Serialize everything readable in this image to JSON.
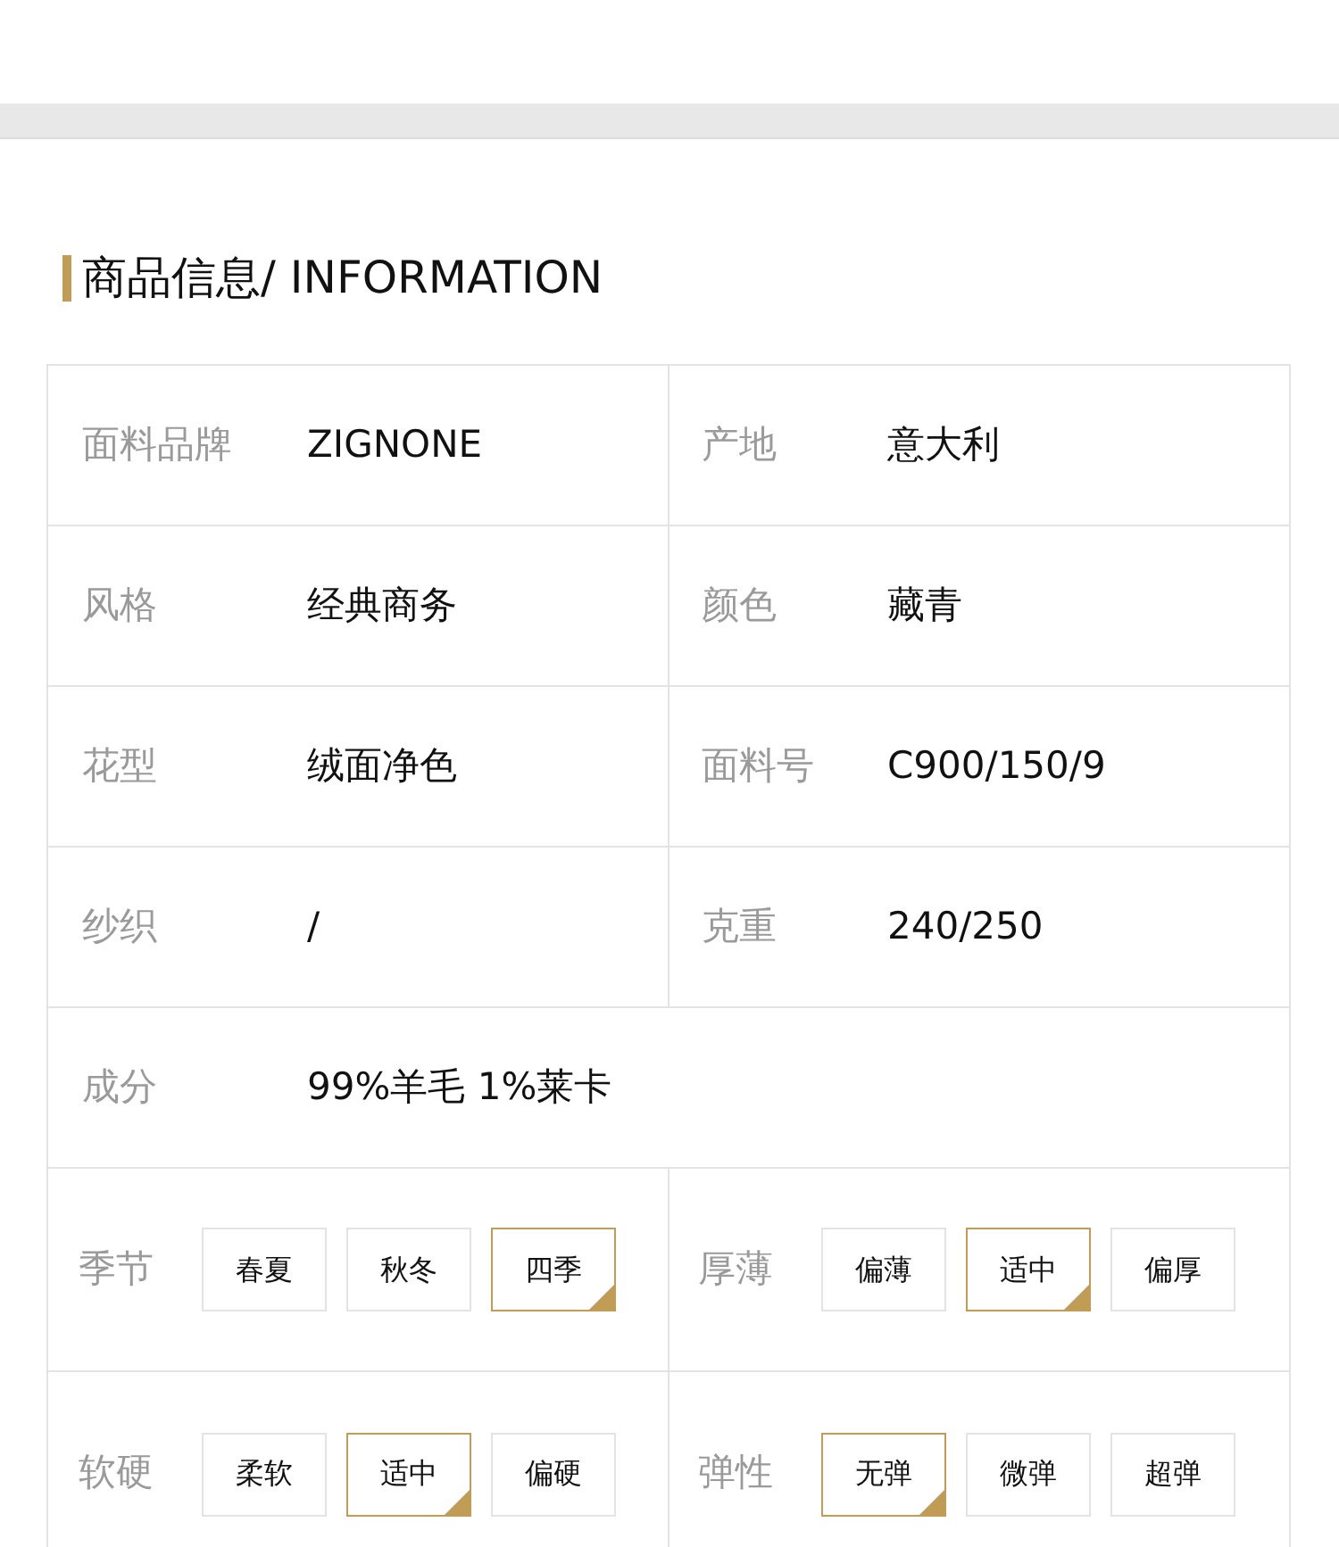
{
  "section_title": "商品信息/ INFORMATION",
  "info_rows": [
    {
      "cells": [
        {
          "label": "面料品牌",
          "value": "ZIGNONE"
        },
        {
          "label": "产地",
          "value": "意大利"
        }
      ]
    },
    {
      "cells": [
        {
          "label": "风格",
          "value": "经典商务"
        },
        {
          "label": "颜色",
          "value": "藏青"
        }
      ]
    },
    {
      "cells": [
        {
          "label": "花型",
          "value": "绒面净色"
        },
        {
          "label": "面料号",
          "value": "C900/150/9"
        }
      ]
    },
    {
      "cells": [
        {
          "label": "纱织",
          "value": "/"
        },
        {
          "label": "克重",
          "value": "240/250"
        }
      ]
    },
    {
      "cells": [
        {
          "label": "成分",
          "value": "99%羊毛 1%莱卡"
        }
      ]
    }
  ],
  "option_rows": [
    {
      "groups": [
        {
          "label": "季节",
          "options": [
            {
              "label": "春夏",
              "selected": false
            },
            {
              "label": "秋冬",
              "selected": false
            },
            {
              "label": "四季",
              "selected": true
            }
          ]
        },
        {
          "label": "厚薄",
          "options": [
            {
              "label": "偏薄",
              "selected": false
            },
            {
              "label": "适中",
              "selected": true
            },
            {
              "label": "偏厚",
              "selected": false
            }
          ]
        }
      ]
    },
    {
      "groups": [
        {
          "label": "软硬",
          "options": [
            {
              "label": "柔软",
              "selected": false
            },
            {
              "label": "适中",
              "selected": true
            },
            {
              "label": "偏硬",
              "selected": false
            }
          ]
        },
        {
          "label": "弹性",
          "options": [
            {
              "label": "无弹",
              "selected": true
            },
            {
              "label": "微弹",
              "selected": false
            },
            {
              "label": "超弹",
              "selected": false
            }
          ]
        }
      ]
    }
  ]
}
